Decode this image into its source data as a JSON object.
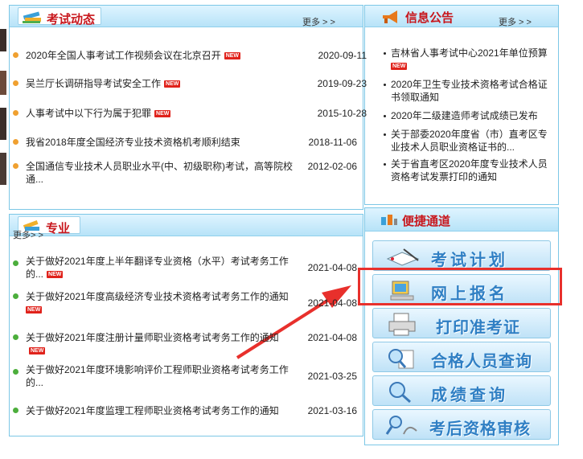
{
  "exam_news": {
    "title": "考试动态",
    "more": "更多 > >",
    "items": [
      {
        "text": "2020年全国人事考试工作视频会议在北京召开",
        "date": "2020-09-11",
        "new": true
      },
      {
        "text": "吴兰厅长调研指导考试安全工作",
        "date": "2019-09-23",
        "new": true
      },
      {
        "text": "人事考试中以下行为属于犯罪",
        "date": "2015-10-28",
        "new": true
      },
      {
        "text": "我省2018年度全国经济专业技术资格机考顺利结束",
        "date": "2018-11-06",
        "new": false
      },
      {
        "text": "全国通信专业技术人员职业水平(中、初级职称)考试，高等院校",
        "text2": "通...",
        "date": "2012-02-06",
        "new": false
      }
    ]
  },
  "notices": {
    "title": "信息公告",
    "more": "更多 > >",
    "items": [
      {
        "line1": "吉林省人事考试中心2021年单位预算",
        "line2": "",
        "new": true
      },
      {
        "line1": "2020年卫生专业技术资格考试合格证",
        "line2": "书领取通知",
        "new": false
      },
      {
        "line1": "2020年二级建造师考试成绩已发布",
        "line2": "",
        "new": false
      },
      {
        "line1": "关于部委2020年度省（市）直考区专",
        "line2": "业技术人员职业资格证书的...",
        "new": false
      },
      {
        "line1": "关于省直考区2020年度专业技术人员",
        "line2": "资格考试发票打印的通知",
        "new": false
      }
    ]
  },
  "professional": {
    "title": "专业",
    "more": "更多",
    "more_arrows": "> >",
    "items": [
      {
        "text": "关于做好2021年度上半年翻译专业资格（水平）考试考务工作",
        "text2": "的...",
        "date": "2021-04-08",
        "new": true
      },
      {
        "text": "关于做好2021年度高级经济专业技术资格考试考务工作的通知",
        "text2": "",
        "date": "2021-04-08",
        "new": true
      },
      {
        "text": "关于做好2021年度注册计量师职业资格考试考务工作的通知",
        "text2": "",
        "date": "2021-04-08",
        "new": true
      },
      {
        "text": "关于做好2021年度环境影响评价工程师职业资格考试考务工作",
        "text2": "的...",
        "date": "2021-03-25",
        "new": false
      },
      {
        "text": "关于做好2021年度监理工程师职业资格考试考务工作的通知",
        "text2": "",
        "date": "2021-03-16",
        "new": false
      }
    ]
  },
  "quick": {
    "title": "便捷通道",
    "buttons": [
      {
        "label": "考试计划",
        "icon": "book-pen-icon"
      },
      {
        "label": "网上报名",
        "icon": "computer-icon"
      },
      {
        "label": "打印准考证",
        "icon": "printer-icon"
      },
      {
        "label": "合格人员查询",
        "icon": "magnifier-doc-icon"
      },
      {
        "label": "成绩查询",
        "icon": "magnifier-icon"
      },
      {
        "label": "考后资格审核",
        "icon": "search-person-icon"
      }
    ]
  },
  "badge_new": "NEW",
  "colors": {
    "accent_red": "#c8171d",
    "link_blue": "#2f7fc4",
    "border": "#7cc7e6",
    "highlight": "#e8302c"
  }
}
